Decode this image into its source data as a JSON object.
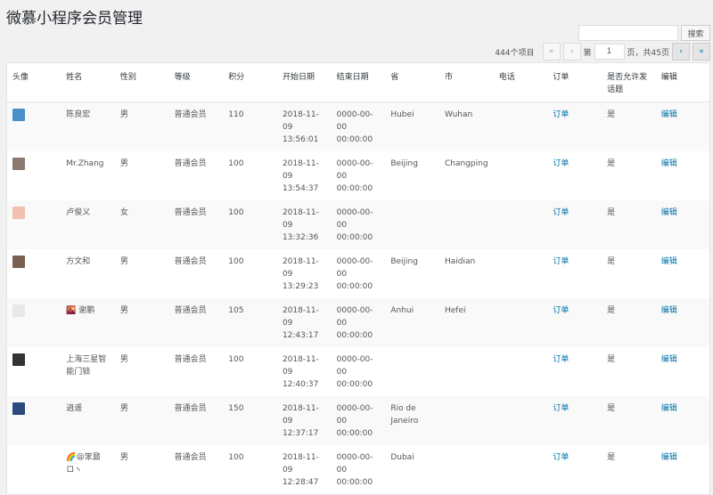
{
  "title": "微慕小程序会员管理",
  "search": {
    "value": "",
    "button": "搜索"
  },
  "pagination": {
    "count": "444个项目",
    "first": "«",
    "prev": "‹",
    "page_prefix": "第",
    "page": "1",
    "page_suffix": "页，共45页",
    "next": "›",
    "last": "»"
  },
  "columns": [
    "头像",
    "姓名",
    "性别",
    "等级",
    "积分",
    "开始日期",
    "结束日期",
    "省",
    "市",
    "电话",
    "订单",
    "是否允许发话题",
    "编辑"
  ],
  "rows": [
    {
      "avatar": "#4a90c8",
      "name": "陈良宏",
      "gender": "男",
      "level": "普通会员",
      "points": "110",
      "start": "2018-11-09 13:56:01",
      "end": "0000-00-00 00:00:00",
      "province": "Hubei",
      "city": "Wuhan",
      "phone": "",
      "order": "订单",
      "allow": "是",
      "edit": "编辑"
    },
    {
      "avatar": "#8a7a70",
      "name": "Mr.Zhang",
      "gender": "男",
      "level": "普通会员",
      "points": "100",
      "start": "2018-11-09 13:54:37",
      "end": "0000-00-00 00:00:00",
      "province": "Beijing",
      "city": "Changping",
      "phone": "",
      "order": "订单",
      "allow": "是",
      "edit": "编辑"
    },
    {
      "avatar": "#f0c0b0",
      "name": "卢俊义",
      "gender": "女",
      "level": "普通会员",
      "points": "100",
      "start": "2018-11-09 13:32:36",
      "end": "0000-00-00 00:00:00",
      "province": "",
      "city": "",
      "phone": "",
      "order": "订单",
      "allow": "是",
      "edit": "编辑"
    },
    {
      "avatar": "#7a6050",
      "name": "方文和",
      "gender": "男",
      "level": "普通会员",
      "points": "100",
      "start": "2018-11-09 13:29:23",
      "end": "0000-00-00 00:00:00",
      "province": "Beijing",
      "city": "Haidian",
      "phone": "",
      "order": "订单",
      "allow": "是",
      "edit": "编辑"
    },
    {
      "avatar": "#e8e8e8",
      "name": "🌇 谢鹏",
      "gender": "男",
      "level": "普通会员",
      "points": "105",
      "start": "2018-11-09 12:43:17",
      "end": "0000-00-00 00:00:00",
      "province": "Anhui",
      "city": "Hefei",
      "phone": "",
      "order": "订单",
      "allow": "是",
      "edit": "编辑"
    },
    {
      "avatar": "#333333",
      "name": "上海三星智能门锁",
      "gender": "男",
      "level": "普通会员",
      "points": "100",
      "start": "2018-11-09 12:40:37",
      "end": "0000-00-00 00:00:00",
      "province": "",
      "city": "",
      "phone": "",
      "order": "订单",
      "allow": "是",
      "edit": "编辑"
    },
    {
      "avatar": "#2a4a80",
      "name": "逍遥",
      "gender": "男",
      "level": "普通会员",
      "points": "150",
      "start": "2018-11-09 12:37:17",
      "end": "0000-00-00 00:00:00",
      "province": "Rio de Janeiro",
      "city": "",
      "phone": "",
      "order": "订单",
      "allow": "是",
      "edit": "编辑"
    },
    {
      "avatar": "#ffffff",
      "name": "🌈😫笨鼐ロヽ",
      "gender": "男",
      "level": "普通会员",
      "points": "100",
      "start": "2018-11-09 12:28:47",
      "end": "0000-00-00 00:00:00",
      "province": "Dubai",
      "city": "",
      "phone": "",
      "order": "订单",
      "allow": "是",
      "edit": "编辑"
    }
  ]
}
